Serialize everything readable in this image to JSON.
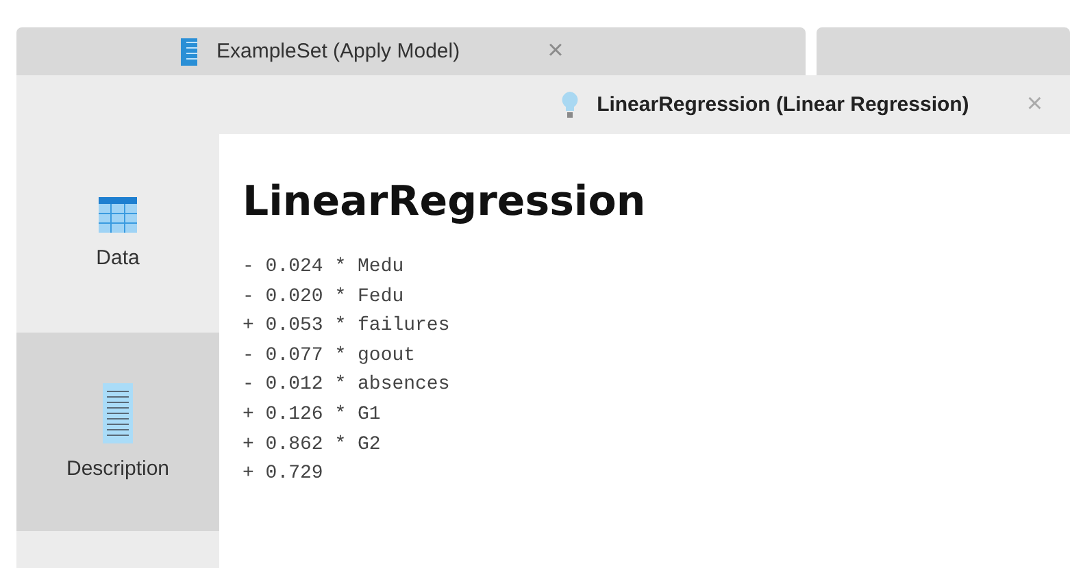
{
  "top_tabs": [
    {
      "label": "ExampleSet (Apply Model)",
      "close": "×",
      "kind": "book"
    }
  ],
  "result_tab": {
    "label": "LinearRegression (Linear Regression)",
    "close": "×"
  },
  "sidebar": {
    "items": [
      {
        "label": "Data",
        "kind": "table",
        "selected": false
      },
      {
        "label": "Description",
        "kind": "document",
        "selected": true
      }
    ]
  },
  "content": {
    "title": "LinearRegression",
    "lines": [
      "- 0.024 * Medu",
      "- 0.020 * Fedu",
      "+ 0.053 * failures",
      "- 0.077 * goout",
      "- 0.012 * absences",
      "+ 0.126 * G1",
      "+ 0.862 * G2",
      "+ 0.729"
    ]
  }
}
